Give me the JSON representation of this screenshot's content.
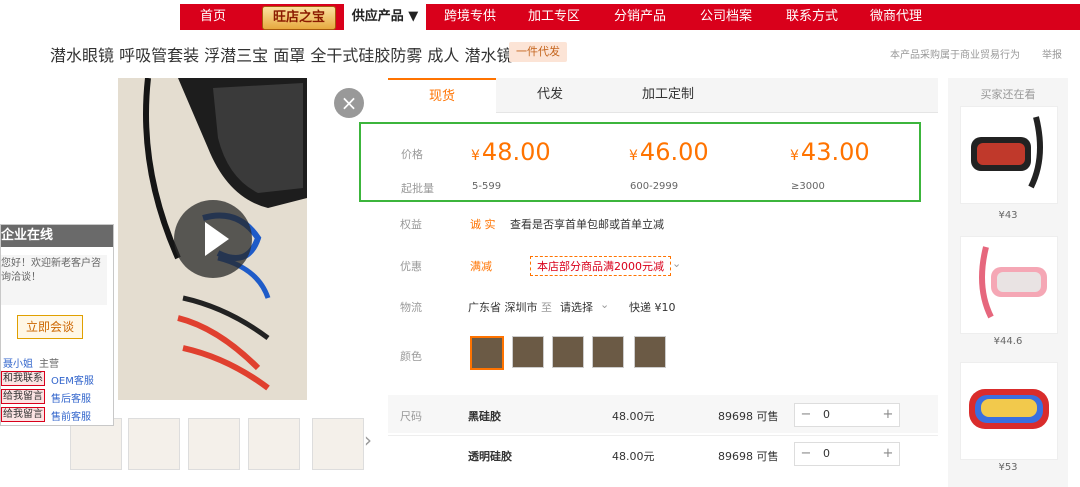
{
  "nav": {
    "items": [
      {
        "label": "首页"
      },
      {
        "label": "旺店之宝"
      },
      {
        "label": "供应产品 ▼"
      },
      {
        "label": "跨境专供"
      },
      {
        "label": "加工专区"
      },
      {
        "label": "分销产品"
      },
      {
        "label": "公司档案"
      },
      {
        "label": "联系方式"
      },
      {
        "label": "微商代理"
      }
    ]
  },
  "product": {
    "title": "潜水眼镜 呼吸管套装 浮潜三宝 面罩 全干式硅胶防雾 成人 潜水镜",
    "tag": "一件代发",
    "note": "本产品采购属于商业贸易行为",
    "report": "举报"
  },
  "chat": {
    "title": "企业在线",
    "greeting": "您好！欢迎新老客户咨询洽谈！",
    "button": "立即会谈",
    "contacts": [
      {
        "tag": "聂小姐",
        "role": "主营"
      },
      {
        "tag": "和我联系",
        "role": "OEM客服"
      },
      {
        "tag": "给我留言",
        "role": "售后客服"
      },
      {
        "tag": "给我留言",
        "role": "售前客服"
      }
    ]
  },
  "tabs": [
    {
      "label": "现货"
    },
    {
      "label": "代发"
    },
    {
      "label": "加工定制"
    }
  ],
  "pricing": {
    "price_label": "价格",
    "qty_label": "起批量",
    "currency": "¥",
    "tiers": [
      {
        "price": "48.00",
        "qty": "5-599"
      },
      {
        "price": "46.00",
        "qty": "600-2999"
      },
      {
        "price": "43.00",
        "qty": "≥3000"
      }
    ]
  },
  "rights": {
    "label": "权益",
    "badge": "诚 实",
    "text": "查看是否享首单包邮或首单立减"
  },
  "promo": {
    "label": "优惠",
    "type": "满减",
    "text": "本店部分商品满2000元减"
  },
  "logistics": {
    "label": "物流",
    "from": "广东省 深圳市",
    "to_word": "至",
    "to": "请选择",
    "shipping": "快递 ¥10"
  },
  "color": {
    "label": "颜色"
  },
  "sku": {
    "label": "尺码",
    "rows": [
      {
        "name": "黑硅胶",
        "price": "48.00元",
        "stock": "89698 可售",
        "qty": "0"
      },
      {
        "name": "透明硅胶",
        "price": "48.00元",
        "stock": "89698 可售",
        "qty": "0"
      }
    ]
  },
  "side": {
    "title": "买家还在看",
    "items": [
      {
        "price": "¥43"
      },
      {
        "price": "¥44.6"
      },
      {
        "price": "¥53"
      }
    ]
  },
  "colors": {
    "brand_red": "#d9001b",
    "accent_orange": "#ff7300",
    "green_border": "#3cb53c"
  }
}
